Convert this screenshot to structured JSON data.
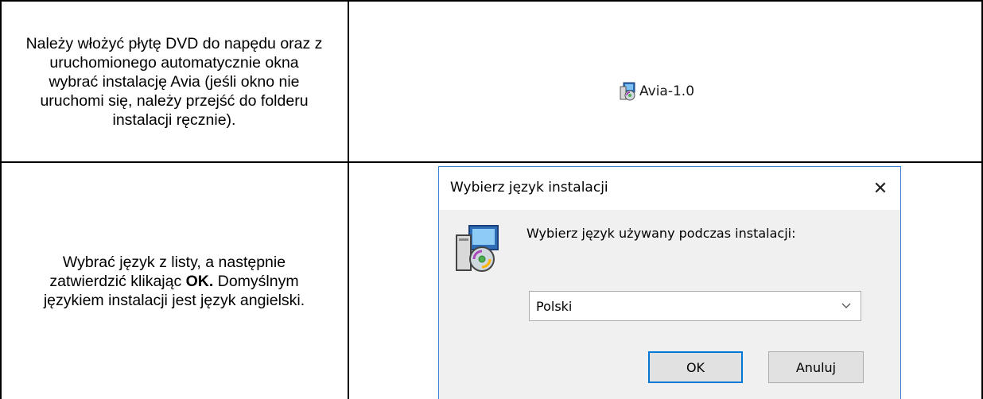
{
  "rows": [
    {
      "instruction": "Należy włożyć płytę DVD do napędu oraz z uruchomionego automatycznie okna wybrać instalację Avia (jeśli okno nie uruchomi się, należy przejść do folderu instalacji ręcznie).",
      "program_label": "Avia-1.0",
      "program_icon": "setup-installer-icon"
    },
    {
      "instruction_before": "Wybrać język z listy, a następnie zatwierdzić klikając ",
      "instruction_bold": "OK.",
      "instruction_after": " Domyślnym językiem instalacji jest język angielski."
    }
  ],
  "dialog": {
    "title": "Wybierz język instalacji",
    "close_glyph": "✕",
    "icon": "setup-installer-icon",
    "prompt": "Wybierz język używany podczas instalacji:",
    "select_value": "Polski",
    "select_icon": "chevron-down-icon",
    "ok_label": "OK",
    "cancel_label": "Anuluj",
    "accent_color": "#0078d7"
  }
}
